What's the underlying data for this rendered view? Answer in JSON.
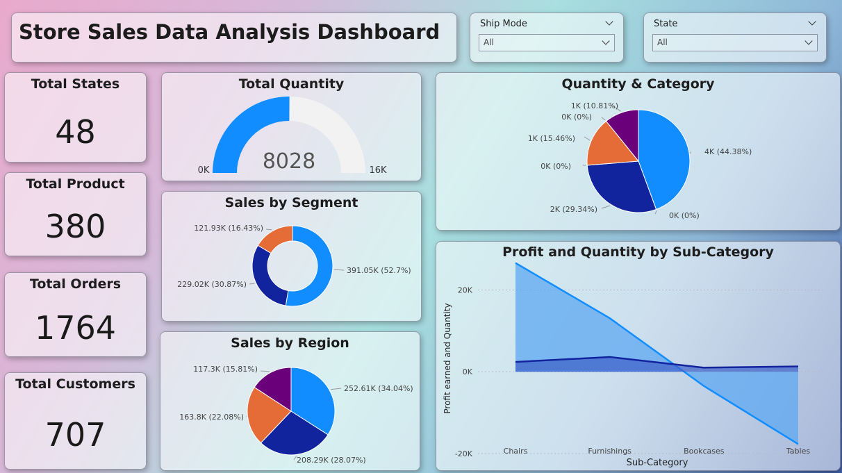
{
  "header": {
    "title": "Store Sales Data Analysis Dashboard"
  },
  "filters": [
    {
      "label": "Ship Mode",
      "value": "All"
    },
    {
      "label": "State",
      "value": "All"
    }
  ],
  "kpis": [
    {
      "label": "Total States",
      "value": "48"
    },
    {
      "label": "Total Product",
      "value": "380"
    },
    {
      "label": "Total Orders",
      "value": "1764"
    },
    {
      "label": "Total Customers",
      "value": "707"
    }
  ],
  "colors": {
    "c1": "#118dff",
    "c2": "#12239e",
    "c3": "#e66c37",
    "c4": "#6b007b",
    "area": "#5ea8f2"
  },
  "chart_data": [
    {
      "type": "gauge",
      "title": "Total Quantity",
      "value": 8028,
      "min": 0,
      "max": 16000,
      "value_label": "8028",
      "min_label": "0K",
      "max_label": "16K"
    },
    {
      "type": "pie",
      "title": "Sales by Segment",
      "donut": true,
      "slices": [
        {
          "value": 391.05,
          "label": "391.05K (52.7%)",
          "color": "#118dff"
        },
        {
          "value": 229.02,
          "label": "229.02K (30.87%)",
          "color": "#12239e"
        },
        {
          "value": 121.93,
          "label": "121.93K (16.43%)",
          "color": "#e66c37"
        }
      ]
    },
    {
      "type": "pie",
      "title": "Sales by Region",
      "slices": [
        {
          "value": 252.61,
          "label": "252.61K (34.04%)",
          "color": "#118dff"
        },
        {
          "value": 208.29,
          "label": "208.29K (28.07%)",
          "color": "#12239e"
        },
        {
          "value": 163.8,
          "label": "163.8K (22.08%)",
          "color": "#e66c37"
        },
        {
          "value": 117.3,
          "label": "117.3K (15.81%)",
          "color": "#6b007b"
        }
      ]
    },
    {
      "type": "pie",
      "title": "Quantity & Category",
      "slices": [
        {
          "value": 44.38,
          "label": "4K (44.38%)",
          "color": "#118dff"
        },
        {
          "value": 0,
          "label": "0K (0%)",
          "color": "#12239e"
        },
        {
          "value": 29.34,
          "label": "2K (29.34%)",
          "color": "#12239e"
        },
        {
          "value": 0,
          "label": "0K (0%)",
          "color": "#e66c37"
        },
        {
          "value": 15.46,
          "label": "1K (15.46%)",
          "color": "#e66c37"
        },
        {
          "value": 0,
          "label": "0K (0%)",
          "color": "#6b007b"
        },
        {
          "value": 10.81,
          "label": "1K (10.81%)",
          "color": "#6b007b"
        }
      ]
    },
    {
      "type": "area",
      "title": "Profit and Quantity by Sub-Category",
      "xlabel": "Sub-Category",
      "ylabel": "Profit earned and Quantity",
      "categories": [
        "Chairs",
        "Furnishings",
        "Bookcases",
        "Tables"
      ],
      "ylim": [
        -20000,
        25000
      ],
      "yticks": [
        {
          "value": 20000,
          "label": "20K"
        },
        {
          "value": 0,
          "label": "0K"
        },
        {
          "value": -20000,
          "label": "-20K"
        }
      ],
      "series": [
        {
          "values": [
            26600,
            13100,
            -3500,
            -17700
          ]
        },
        {
          "values": [
            2400,
            3600,
            1000,
            1300
          ]
        }
      ]
    }
  ]
}
